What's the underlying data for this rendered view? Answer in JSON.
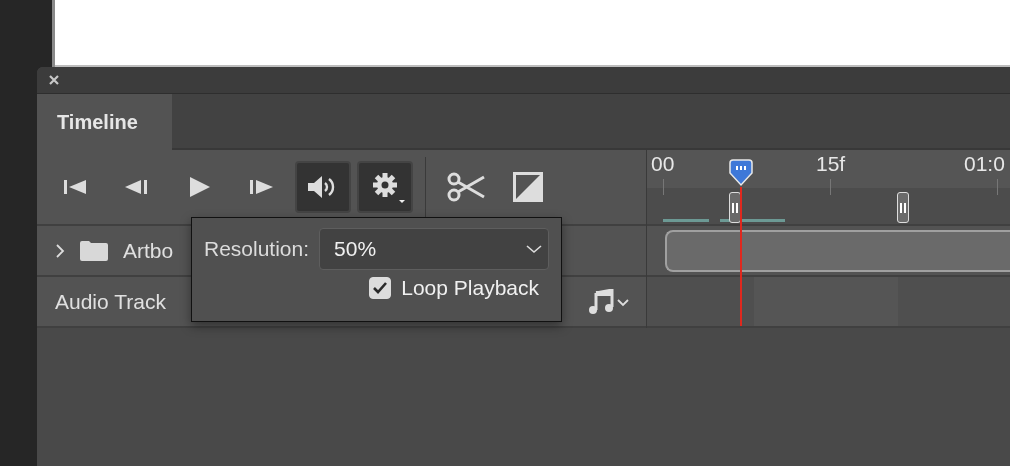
{
  "tabs": [
    {
      "label": "Timeline",
      "selected": true
    }
  ],
  "controls": [
    {
      "kind": "first-frame"
    },
    {
      "kind": "previous-frame"
    },
    {
      "kind": "play"
    },
    {
      "kind": "next-frame"
    },
    {
      "kind": "audio"
    },
    {
      "kind": "settings"
    },
    {
      "kind": "split"
    },
    {
      "kind": "transition"
    }
  ],
  "ruler": {
    "labels": [
      "00",
      "15f",
      "01:0"
    ]
  },
  "tracks": [
    {
      "kind": "group",
      "label": "Artbo",
      "expanded": false
    },
    {
      "kind": "audio",
      "label": "Audio Track"
    }
  ],
  "popup": {
    "resolution_label": "Resolution:",
    "resolution_value": "50%",
    "loop_playback": {
      "label": "Loop Playback",
      "checked": true
    }
  }
}
